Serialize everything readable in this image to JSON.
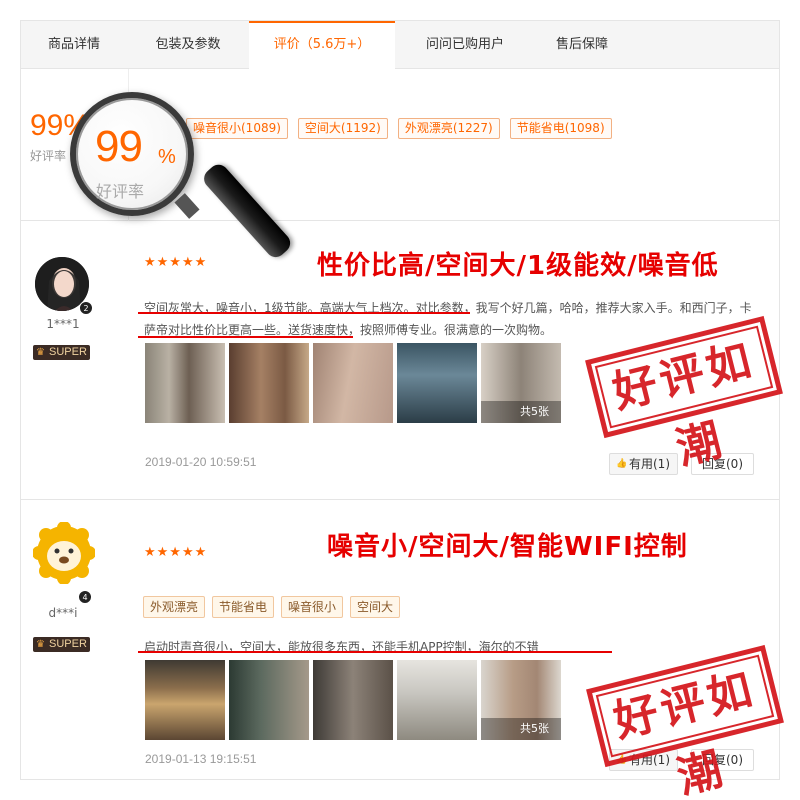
{
  "tabs": [
    {
      "label": "商品详情"
    },
    {
      "label": "包装及参数"
    },
    {
      "label": "评价（5.6万+）"
    },
    {
      "label": "问问已购用户"
    },
    {
      "label": "售后保障"
    }
  ],
  "active_tab_index": 2,
  "summary": {
    "rate_value": "99%",
    "rate_label": "好评率",
    "tags": [
      "噪音很小(1089)",
      "空间大(1192)",
      "外观漂亮(1227)",
      "节能省电(1098)"
    ]
  },
  "magnifier": {
    "value": "99",
    "percent": "%",
    "label": "好评率"
  },
  "reviews": [
    {
      "username": "1***1",
      "level": "2",
      "badge": "SUPER",
      "stars": "★★★★★",
      "rating": 5,
      "headline": "性价比高/空间大/1级能效/噪音低",
      "text": "空间灰常大，噪音小，1级节能。高端大气上档次。对比参数，我写个好几篇，哈哈，推荐大家入手。和西门子，卡萨帝对比性价比更高一些。送货速度快，按照师傅专业。很满意的一次购物。",
      "photo_count": "共5张",
      "date": "2019-01-20 10:59:51",
      "like_label": "有用(1)",
      "reply_label": "回复(0)",
      "stamp": "好评如潮"
    },
    {
      "username": "d***i",
      "level": "4",
      "badge": "SUPER",
      "stars": "★★★★★",
      "rating": 5,
      "headline": "噪音小/空间大/智能WIFI控制",
      "tags": [
        "外观漂亮",
        "节能省电",
        "噪音很小",
        "空间大"
      ],
      "text": "启动时声音很小，空间大，能放很多东西，还能手机APP控制，海尔的不错",
      "photo_count": "共5张",
      "date": "2019-01-13 19:15:51",
      "like_label": "有用(1)",
      "reply_label": "回复(0)",
      "stamp": "好评如潮"
    }
  ],
  "colors": {
    "accent": "#ff6600",
    "headline_red": "#e60000",
    "stamp_red": "#d4141a"
  }
}
